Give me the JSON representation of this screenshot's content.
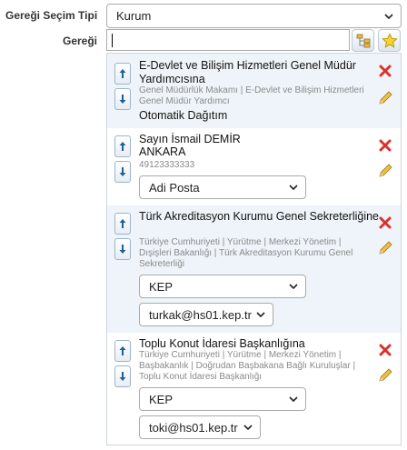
{
  "form": {
    "secim_label": "Gereği Seçim Tipi",
    "secim_value": "Kurum",
    "geregi_label": "Gereği",
    "geregi_value": ""
  },
  "toolbar": {
    "tree_icon": "org-tree-icon",
    "favorites_icon": "star-icon"
  },
  "items": [
    {
      "title": "E-Devlet ve Bilişim Hizmetleri Genel Müdür Yardımcısına",
      "path": "Genel Müdürlük Makamı | E-Devlet ve Bilişim Hizmetleri Genel Müdür Yardımcı",
      "distribution": "Otomatik Dağıtım"
    },
    {
      "title": "Sayın İsmail DEMİR",
      "city": "ANKARA",
      "id_number": "49123333333",
      "delivery": "Adi Posta"
    },
    {
      "title": "Türk Akreditasyon Kurumu Genel Sekreterliğine",
      "path": "Türkiye Cumhuriyeti | Yürütme | Merkezi Yönetim | Dışişleri Bakanlığı | Türk Akreditasyon Kurumu Genel Sekreterliği",
      "delivery": "KEP",
      "kep_address": "turkak@hs01.kep.tr"
    },
    {
      "title": "Toplu Konut İdaresi Başkanlığına",
      "path": "Türkiye Cumhuriyeti | Yürütme | Merkezi Yönetim | Başbakanlık | Doğrudan Başbakana Bağlı Kuruluşlar | Toplu Konut İdaresi Başkanlığı",
      "delivery": "KEP",
      "kep_address": "toki@hs01.kep.tr"
    }
  ],
  "colors": {
    "delete": "#d9322a",
    "card_blue": "#eef4f9",
    "arrow": "#1f5f99"
  }
}
